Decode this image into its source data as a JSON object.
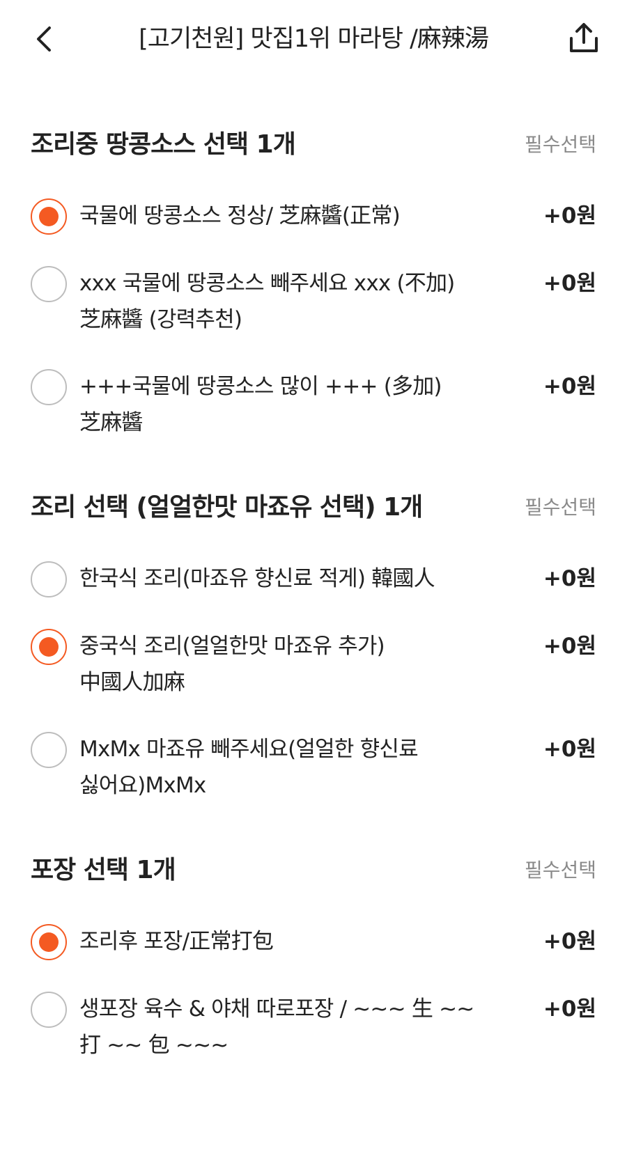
{
  "header": {
    "title": "[고기천원] 맛집1위 마라탕 /麻辣湯",
    "back_icon": "chevron-left-icon",
    "share_icon": "share-icon"
  },
  "colors": {
    "accent": "#f45a22",
    "muted_text": "#8a8a8a",
    "radio_border": "#bdbdbd"
  },
  "sections": [
    {
      "title": "조리중 땅콩소스 선택 1개",
      "badge": "필수선택",
      "options": [
        {
          "label": "국물에 땅콩소스 정상/ 芝麻醬(正常)",
          "price": "+0원",
          "checked": true
        },
        {
          "label": "xxx 국물에 땅콩소스 빼주세요 xxx (不加)芝麻醬 (강력추천)",
          "price": "+0원",
          "checked": false
        },
        {
          "label": "+++국물에 땅콩소스 많이 +++ (多加)芝麻醬",
          "price": "+0원",
          "checked": false
        }
      ]
    },
    {
      "title": "조리 선택 (얼얼한맛 마죠유 선택) 1개",
      "badge": "필수선택",
      "options": [
        {
          "label": "한국식 조리(마죠유 향신료 적게) 韓國人",
          "price": "+0원",
          "checked": false
        },
        {
          "label": "중국식 조리(얼얼한맛 마죠유 추가) 中國人加麻",
          "price": "+0원",
          "checked": true
        },
        {
          "label": "MxMx 마죠유 빼주세요(얼얼한 향신료 싫어요)MxMx",
          "price": "+0원",
          "checked": false
        }
      ]
    },
    {
      "title": "포장 선택 1개",
      "badge": "필수선택",
      "options": [
        {
          "label": "조리후 포장/正常打包",
          "price": "+0원",
          "checked": true
        },
        {
          "label": "생포장 육수 & 야채 따로포장 / ~~~ 生 ~~ 打 ~~ 包 ~~~",
          "price": "+0원",
          "checked": false
        }
      ]
    }
  ]
}
